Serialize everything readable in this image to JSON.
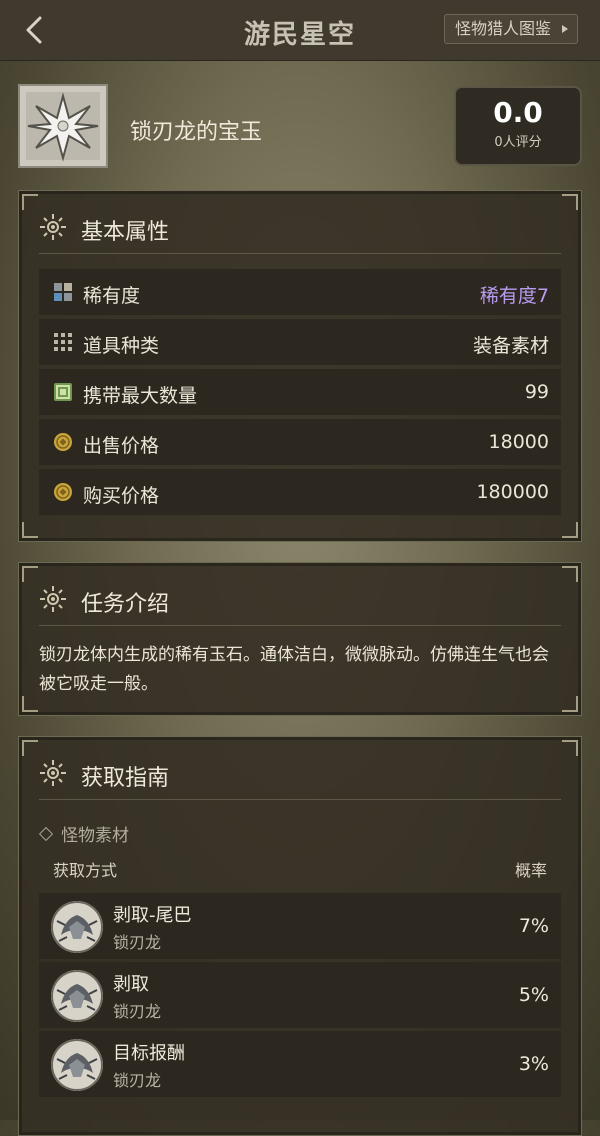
{
  "header": {
    "brand": "游民星空",
    "guide_button": "怪物猎人图鉴"
  },
  "item": {
    "name": "锁刃龙的宝玉",
    "score": "0.0",
    "score_count": "0人评分"
  },
  "basic": {
    "title": "基本属性",
    "rows": [
      {
        "label": "稀有度",
        "value": "稀有度7",
        "icon": "rarity-icon"
      },
      {
        "label": "道具种类",
        "value": "装备素材",
        "icon": "grid-icon"
      },
      {
        "label": "携带最大数量",
        "value": "99",
        "icon": "bag-icon"
      },
      {
        "label": "出售价格",
        "value": "18000",
        "icon": "coin-icon"
      },
      {
        "label": "购买价格",
        "value": "180000",
        "icon": "coin-icon"
      }
    ]
  },
  "intro": {
    "title": "任务介绍",
    "text": "锁刃龙体内生成的稀有玉石。通体洁白，微微脉动。仿佛连生气也会被它吸走一般。"
  },
  "obtain": {
    "title": "获取指南",
    "subtitle": "怪物素材",
    "col_method": "获取方式",
    "col_rate": "概率",
    "rows": [
      {
        "method": "剥取-尾巴",
        "monster": "锁刃龙",
        "rate": "7%"
      },
      {
        "method": "剥取",
        "monster": "锁刃龙",
        "rate": "5%"
      },
      {
        "method": "目标报酬",
        "monster": "锁刃龙",
        "rate": "3%"
      }
    ]
  },
  "colors": {
    "rarity_value": "#b79cf0",
    "panel_bg": "#342f24",
    "row_bg": "#2c2820"
  }
}
